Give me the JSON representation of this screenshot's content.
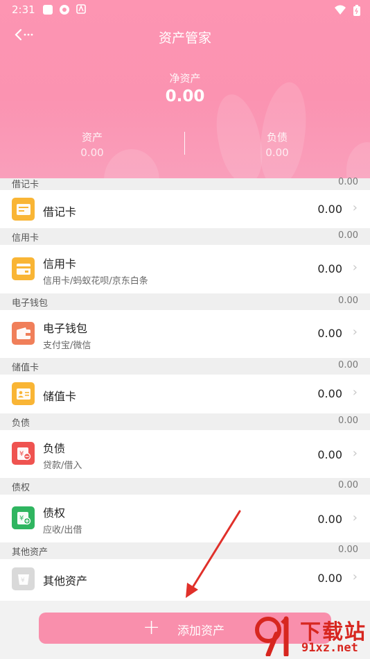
{
  "status_bar": {
    "time": "2:31"
  },
  "header": {
    "back_glyph": "‹··· ",
    "title": "资产管家",
    "net_assets_label": "净资产",
    "net_assets_value": "0.00",
    "assets_label": "资产",
    "assets_value": "0.00",
    "liabilities_label": "负债",
    "liabilities_value": "0.00"
  },
  "sections": [
    {
      "name": "借记卡",
      "total": "0.00",
      "row": {
        "title": "借记卡",
        "subtitle": "",
        "amount": "0.00",
        "icon": "debit-card-icon",
        "icon_color": "#f9b535"
      }
    },
    {
      "name": "信用卡",
      "total": "0.00",
      "row": {
        "title": "信用卡",
        "subtitle": "信用卡/蚂蚁花呗/京东白条",
        "amount": "0.00",
        "icon": "credit-card-icon",
        "icon_color": "#f9b535"
      }
    },
    {
      "name": "电子钱包",
      "total": "0.00",
      "row": {
        "title": "电子钱包",
        "subtitle": "支付宝/微信",
        "amount": "0.00",
        "icon": "wallet-icon",
        "icon_color": "#f07f5a"
      }
    },
    {
      "name": "储值卡",
      "total": "0.00",
      "row": {
        "title": "储值卡",
        "subtitle": "",
        "amount": "0.00",
        "icon": "stored-value-card-icon",
        "icon_color": "#f9b535"
      }
    },
    {
      "name": "负债",
      "total": "0.00",
      "row": {
        "title": "负债",
        "subtitle": "贷款/借入",
        "amount": "0.00",
        "icon": "liability-icon",
        "icon_color": "#ef5350"
      }
    },
    {
      "name": "债权",
      "total": "0.00",
      "row": {
        "title": "债权",
        "subtitle": "应收/出借",
        "amount": "0.00",
        "icon": "claim-icon",
        "icon_color": "#2fb560"
      }
    },
    {
      "name": "其他资产",
      "total": "0.00",
      "row": {
        "title": "其他资产",
        "subtitle": "",
        "amount": "0.00",
        "icon": "other-assets-icon",
        "icon_color": "#d9d9d9"
      }
    }
  ],
  "add_button": {
    "plus": "+",
    "label": "添加资产"
  },
  "watermark": {
    "top": "下载站",
    "bottom": "91xz.net"
  },
  "colors": {
    "header_pink": "#fb93b1",
    "button_pink": "#f98fac",
    "arrow_red": "#e0302a",
    "watermark_red": "#d7261f"
  }
}
